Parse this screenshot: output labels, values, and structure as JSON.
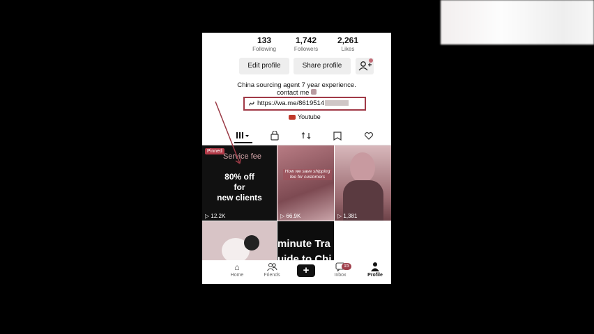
{
  "profile": {
    "stats": [
      {
        "value": "133",
        "label": "Following"
      },
      {
        "value": "1,742",
        "label": "Followers"
      },
      {
        "value": "2,261",
        "label": "Likes"
      }
    ],
    "edit_label": "Edit profile",
    "share_label": "Share profile",
    "bio_line1": "China sourcing agent 7 year experience.",
    "bio_line2": "contact me",
    "link_text": "https://wa.me/8619514",
    "youtube_label": "Youtube"
  },
  "tabs": [
    "videos-grid",
    "private",
    "reposts",
    "favorites",
    "liked"
  ],
  "videos": [
    {
      "pinned": "Pinned",
      "top_text": "Service fee",
      "title": "80% off\nfor\nnew clients",
      "views": "12.2K"
    },
    {
      "caption": "How we save shipping fee for customers",
      "views": "66.9K"
    },
    {
      "caption": "",
      "views": "1,381"
    },
    {
      "caption": "",
      "views": ""
    },
    {
      "text": "minute Tra\nuide to Chi",
      "views": ""
    }
  ],
  "nav": {
    "home": "Home",
    "friends": "Friends",
    "inbox": "Inbox",
    "inbox_badge": "15",
    "profile": "Profile"
  },
  "colors": {
    "accent": "#a03a47",
    "nav_active": "#111111"
  }
}
